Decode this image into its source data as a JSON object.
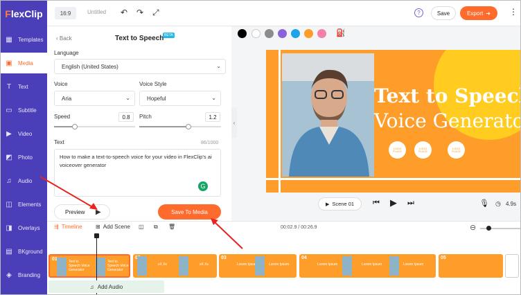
{
  "app": {
    "logo": "FlexClip",
    "logo_first": "F",
    "logo_rest": "lexClip"
  },
  "colors": {
    "brand": "#4a3fb8",
    "accent": "#ff6b2c",
    "canvas": "#ff9d2a"
  },
  "leftnav": {
    "items": [
      {
        "label": "Templates",
        "icon": "templates-icon"
      },
      {
        "label": "Media",
        "icon": "media-icon"
      },
      {
        "label": "Text",
        "icon": "text-icon"
      },
      {
        "label": "Subtitle",
        "icon": "subtitle-icon"
      },
      {
        "label": "Video",
        "icon": "video-icon"
      },
      {
        "label": "Photo",
        "icon": "photo-icon"
      },
      {
        "label": "Audio",
        "icon": "audio-icon"
      },
      {
        "label": "Elements",
        "icon": "elements-icon"
      },
      {
        "label": "Overlays",
        "icon": "overlays-icon"
      },
      {
        "label": "BKground",
        "icon": "bkground-icon"
      },
      {
        "label": "Branding",
        "icon": "branding-icon"
      }
    ],
    "active": "Media"
  },
  "topbar": {
    "ratio": "16:9",
    "project_name": "Untitled",
    "save_label": "Save",
    "export_label": "Export"
  },
  "panel": {
    "back_label": "Back",
    "title": "Text to Speech",
    "beta": "BETA",
    "language_label": "Language",
    "language_value": "English (United States)",
    "voice_label": "Voice",
    "voice_value": "Aria",
    "style_label": "Voice Style",
    "style_value": "Hopeful",
    "speed_label": "Speed",
    "speed_value": "0.8",
    "pitch_label": "Pitch",
    "pitch_value": "1.2",
    "text_label": "Text",
    "text_count": "86/1000",
    "text_value": "How to make a text-to-speech voice for your video in FlexClip's ai voiceover generator",
    "preview_label": "Preview",
    "save_media_label": "Save To Media"
  },
  "canvas": {
    "headline1": "Text to Speech",
    "headline2": "Voice Generator",
    "logo_place": "LOGO PLACE"
  },
  "playbar": {
    "scene": "Scene 01",
    "duration": "4.9s"
  },
  "timeline": {
    "tab_label": "Timeline",
    "add_scene_label": "Add Scene",
    "time": "00:02.9 / 00:26.9",
    "add_audio_label": "Add Audio",
    "clips": [
      {
        "num": "01",
        "caption": "Text to Speech Voice Generator"
      },
      {
        "num": "02",
        "caption": "xX Xx"
      },
      {
        "num": "03",
        "caption": "Lorem Ipsum"
      },
      {
        "num": "04",
        "caption": "Lorem Ipsum"
      },
      {
        "num": "05",
        "caption": ""
      }
    ]
  }
}
